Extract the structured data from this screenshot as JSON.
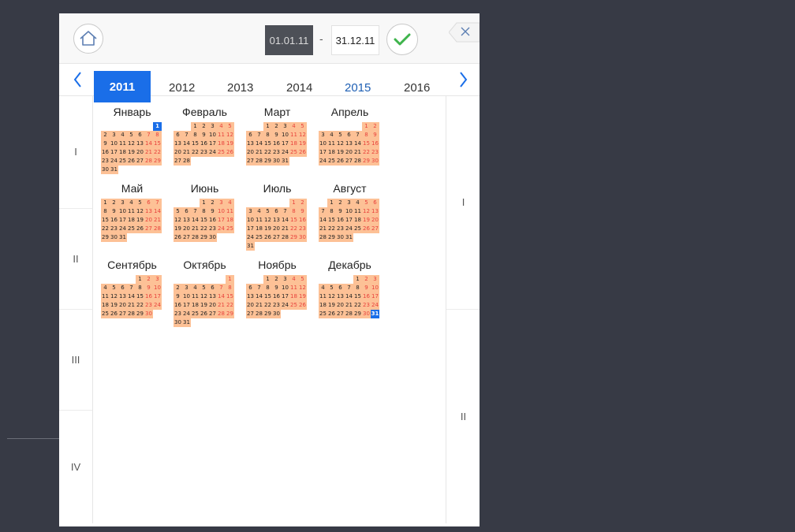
{
  "header": {
    "date_from": "01.01.11",
    "date_separator": "-",
    "date_to": "31.12.11"
  },
  "colors": {
    "accent": "#1a6ee8",
    "day_bg": "#fdc196",
    "weekend_text": "#e8423c",
    "confirm": "#3fb44c",
    "background": "#373a45"
  },
  "icons": {
    "home": "home-icon",
    "confirm": "checkmark-icon",
    "close": "close-icon",
    "prev": "chevron-left-icon",
    "next": "chevron-right-icon"
  },
  "years": {
    "active": "2011",
    "others": [
      "2012",
      "2013",
      "2014",
      "2015",
      "2016"
    ]
  },
  "quarters": [
    "I",
    "II",
    "III",
    "IV"
  ],
  "halves": [
    "I",
    "II"
  ],
  "months": [
    {
      "name": "Январь",
      "start": 6,
      "days": 31
    },
    {
      "name": "Февраль",
      "start": 2,
      "days": 28
    },
    {
      "name": "Март",
      "start": 2,
      "days": 31
    },
    {
      "name": "Апрель",
      "start": 5,
      "days": 30
    },
    {
      "name": "Май",
      "start": 0,
      "days": 31
    },
    {
      "name": "Июнь",
      "start": 3,
      "days": 30
    },
    {
      "name": "Июль",
      "start": 5,
      "days": 31
    },
    {
      "name": "Август",
      "start": 1,
      "days": 31
    },
    {
      "name": "Сентябрь",
      "start": 4,
      "days": 30
    },
    {
      "name": "Октябрь",
      "start": 6,
      "days": 31
    },
    {
      "name": "Ноябрь",
      "start": 2,
      "days": 30
    },
    {
      "name": "Декабрь",
      "start": 4,
      "days": 31
    }
  ],
  "selected": [
    {
      "month": 0,
      "day": 1
    },
    {
      "month": 11,
      "day": 31
    }
  ]
}
